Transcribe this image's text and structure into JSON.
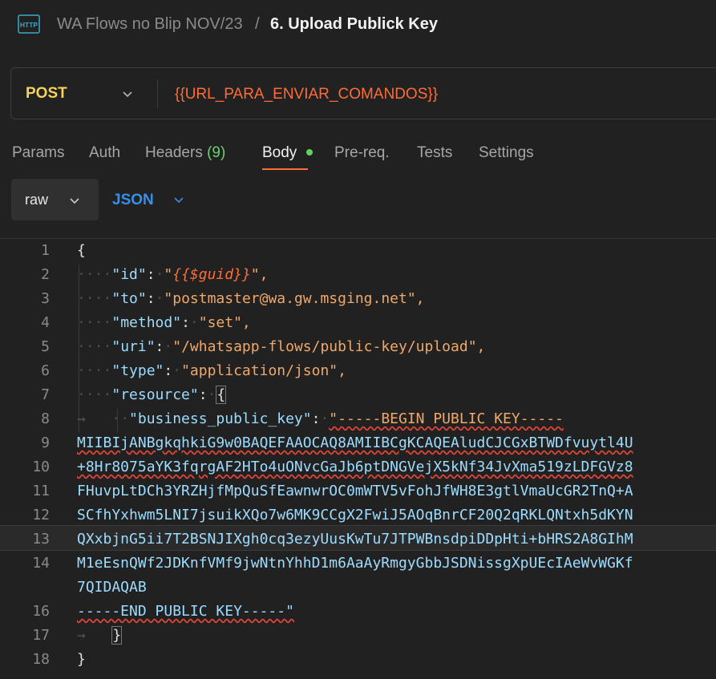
{
  "header": {
    "icon": "http-icon",
    "icon_text": "HTTP",
    "collection": "WA Flows no Blip NOV/23",
    "separator": "/",
    "request_name": "6. Upload Publick Key"
  },
  "request": {
    "method": "POST",
    "url": "{{URL_PARA_ENVIAR_COMANDOS}}"
  },
  "tabs": [
    {
      "label": "Params"
    },
    {
      "label": "Auth"
    },
    {
      "label": "Headers",
      "count": "(9)"
    },
    {
      "label": "Body",
      "active": true
    },
    {
      "label": "Pre-req."
    },
    {
      "label": "Tests"
    },
    {
      "label": "Settings"
    }
  ],
  "body_mode": {
    "type": "raw",
    "format": "JSON"
  },
  "editor": {
    "line_numbers": [
      "1",
      "2",
      "3",
      "4",
      "5",
      "6",
      "7",
      "8",
      "9",
      "10",
      "11",
      "12",
      "13",
      "14",
      "",
      "16",
      "17",
      "18"
    ],
    "lines": {
      "l1": "{",
      "l2_key": "\"id\"",
      "l2_q1": "\"",
      "l2_var": "{{$guid}}",
      "l2_q2": "\",",
      "l3_key": "\"to\"",
      "l3_val": "\"postmaster@wa.gw.msging.net\",",
      "l4_key": "\"method\"",
      "l4_val": "\"set\",",
      "l5_key": "\"uri\"",
      "l5_val": "\"/whatsapp-flows/public-key/upload\",",
      "l6_key": "\"type\"",
      "l6_val": "\"application/json\",",
      "l7_key": "\"resource\"",
      "l7_val": "{",
      "l8_key": "\"business_public_key\"",
      "l8_val": "\"-----BEGIN PUBLIC KEY-----",
      "l9": "MIIBIjANBgkqhkiG9w0BAQEFAAOCAQ8AMIIBCgKCAQEAludCJCGxBTWDfvuytl4U",
      "l10": "+8Hr8075aYK3fqrgAF2HTo4uONvcGaJb6ptDNGVejX5kNf34JvXma519zLDFGVz8",
      "l11": "FHuvpLtDCh3YRZHjfMpQuSfEawnwrOC0mWTV5vFohJfWH8E3gtlVmaUcGR2TnQ+A",
      "l12": "SCfhYxhwm5LNI7jsuikXQo7w6MK9CCgX2FwiJ5AOqBnrCF20Q2qRKLQNtxh5dKYN",
      "l13": "QXxbjnG5ii7T2BSNJIXgh0cq3ezyUusKwTu7JTPWBnsdpiDDpHti+bHRS2A8GIhM",
      "l14": "M1eEsnQWf2JDKnfVMf9jwNtnYhhD1m6AaAyRmgyGbbJSDNissgXpUEcIAeWvWGKf",
      "l15": "7QIDAQAB",
      "l16": "-----END PUBLIC KEY-----\"",
      "l17": "}",
      "l18": "}"
    }
  },
  "colors": {
    "accent": "#ff6c37",
    "method_post": "#f5d35b",
    "json_blue": "#3a8ee6",
    "status_green": "#5fd35f"
  }
}
